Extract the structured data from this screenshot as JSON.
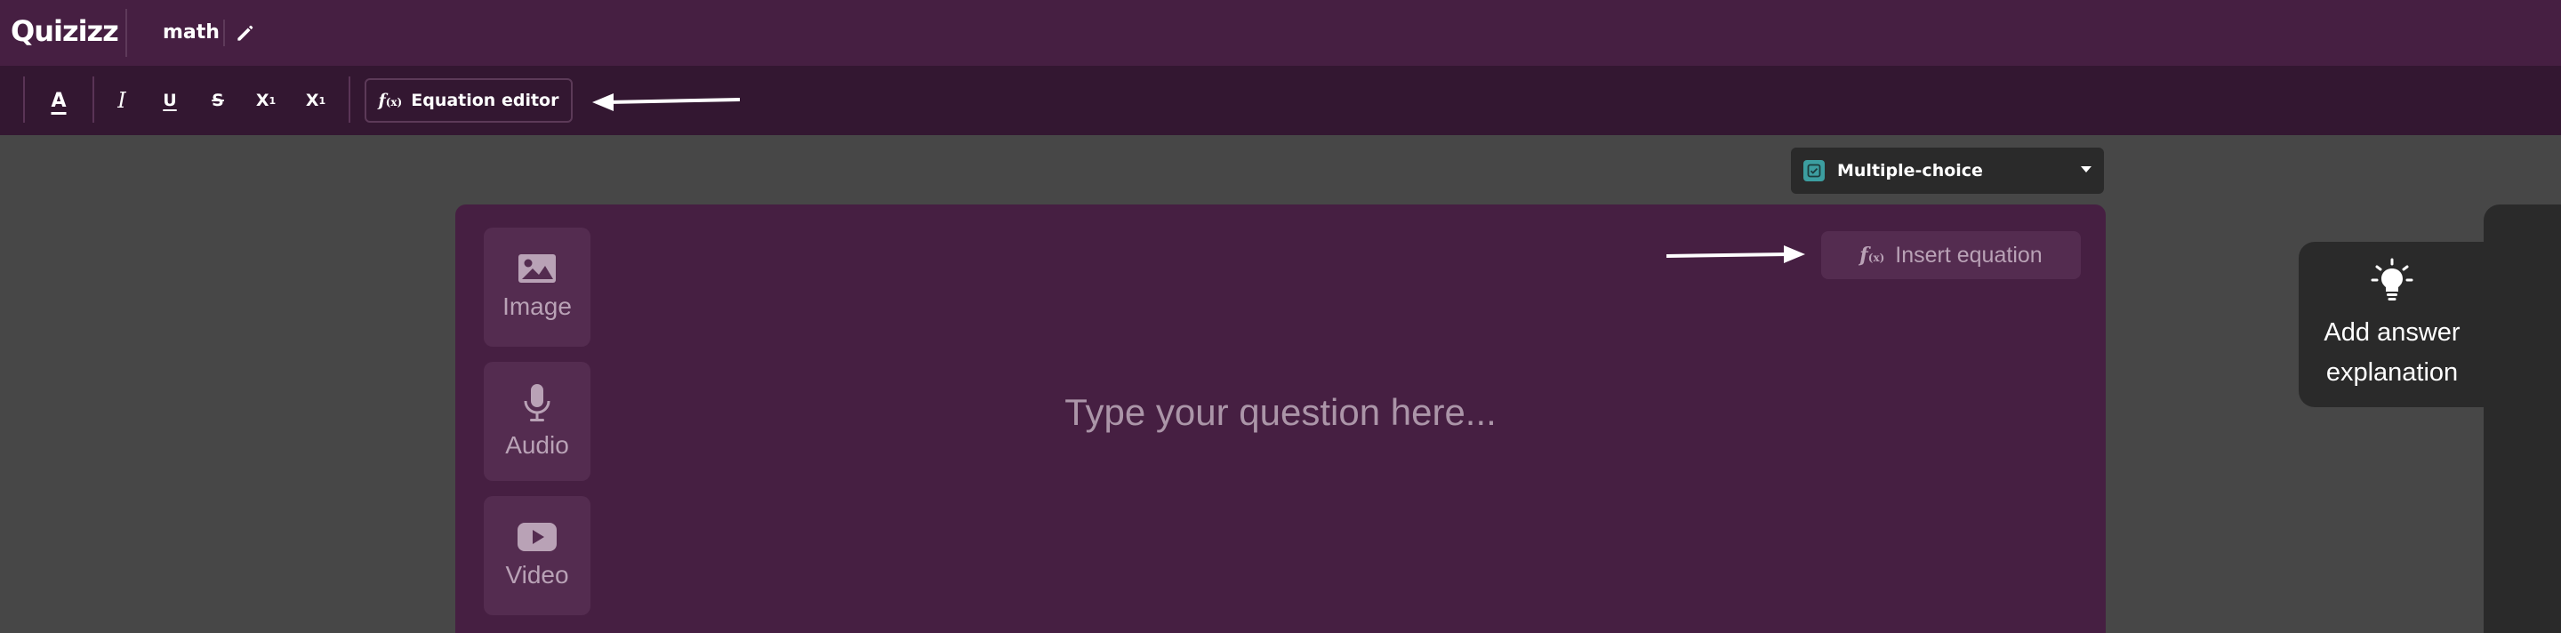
{
  "app": {
    "logo": "Quizizz",
    "quiz_title": "math"
  },
  "toolbar": {
    "text_color": "A",
    "italic": "I",
    "underline": "U",
    "strikethrough": "S",
    "superscript_base": "X",
    "superscript_mark": "1",
    "subscript_base": "X",
    "subscript_mark": "1",
    "equation_editor_fx": "f",
    "equation_editor_fx_sub": "(x)",
    "equation_editor_label": "Equation editor"
  },
  "question_type": {
    "selected": "Multiple-choice",
    "icon": "checkbox-icon",
    "accent": "#3c9ea0"
  },
  "question_card": {
    "media": [
      {
        "label": "Image",
        "icon": "image-icon"
      },
      {
        "label": "Audio",
        "icon": "microphone-icon"
      },
      {
        "label": "Video",
        "icon": "video-play-icon"
      }
    ],
    "insert_equation_fx": "f",
    "insert_equation_fx_sub": "(x)",
    "insert_equation_label": "Insert equation",
    "placeholder": "Type your question here..."
  },
  "side_panel": {
    "answer_explanation_label": "Add answer explanation",
    "icon": "lightbulb-icon"
  },
  "colors": {
    "header_bg": "#461f42",
    "toolbar_bg": "#331731",
    "canvas_bg": "#474747",
    "card_bg": "#461f42",
    "tile_bg": "#542c50",
    "panel_bg": "#2a2a2a"
  }
}
